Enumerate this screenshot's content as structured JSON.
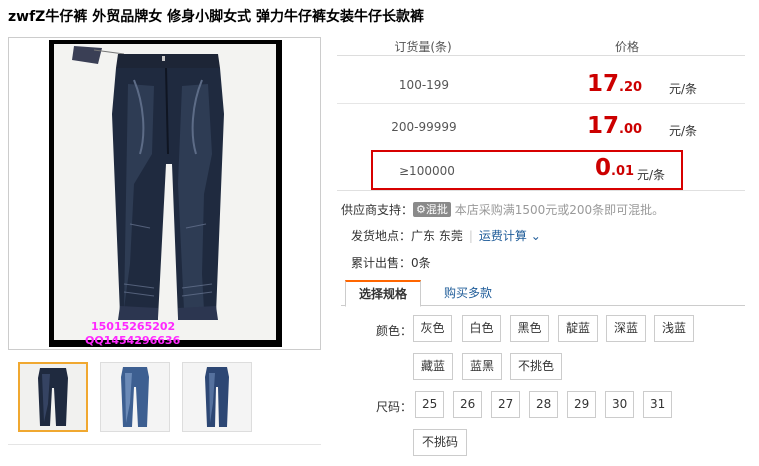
{
  "title": "zwfZ牛仔裤 外贸品牌女 修身小脚女式 弹力牛仔裤女装牛仔长款裤",
  "gallery": {
    "main_watermark": [
      "15015265202",
      "QQ1454296636"
    ],
    "thumbnails": [
      "thumb-jeans-black",
      "thumb-jeans-blue",
      "thumb-jeans-mid"
    ]
  },
  "price_table": {
    "header_qty": "订货量(条)",
    "header_price": "价格",
    "tiers": [
      {
        "range": "100-199",
        "price_int": "17",
        "price_dec": ".20",
        "unit": "元/条"
      },
      {
        "range": "200-99999",
        "price_int": "17",
        "price_dec": ".00",
        "unit": "元/条"
      }
    ],
    "highlight": {
      "range": "≥100000",
      "price_int": "0",
      "price_dec": ".01",
      "unit": "元/条"
    }
  },
  "supplier": {
    "label": "供应商支持：",
    "badge": "混批",
    "note": "本店采购满1500元或200条即可混批。"
  },
  "shipping": {
    "label": "发货地点：",
    "location": "广东 东莞",
    "link": "运费计算"
  },
  "sold": {
    "label": "累计出售：",
    "value": "0条"
  },
  "tabs": {
    "active": "选择规格",
    "other": "购买多款"
  },
  "specs": {
    "color_label": "颜色：",
    "colors": [
      "灰色",
      "白色",
      "黑色",
      "靛蓝",
      "深蓝",
      "浅蓝",
      "藏蓝",
      "蓝黑",
      "不挑色"
    ],
    "size_label": "尺码：",
    "sizes": [
      "25",
      "26",
      "27",
      "28",
      "29",
      "30",
      "31",
      "不挑码"
    ]
  },
  "colors": {
    "price_red": "#cc0000",
    "highlight_border": "#d70000",
    "link_blue": "#1f5c99",
    "tab_accent": "#ff6600",
    "thumb_selected": "#f0a830"
  }
}
